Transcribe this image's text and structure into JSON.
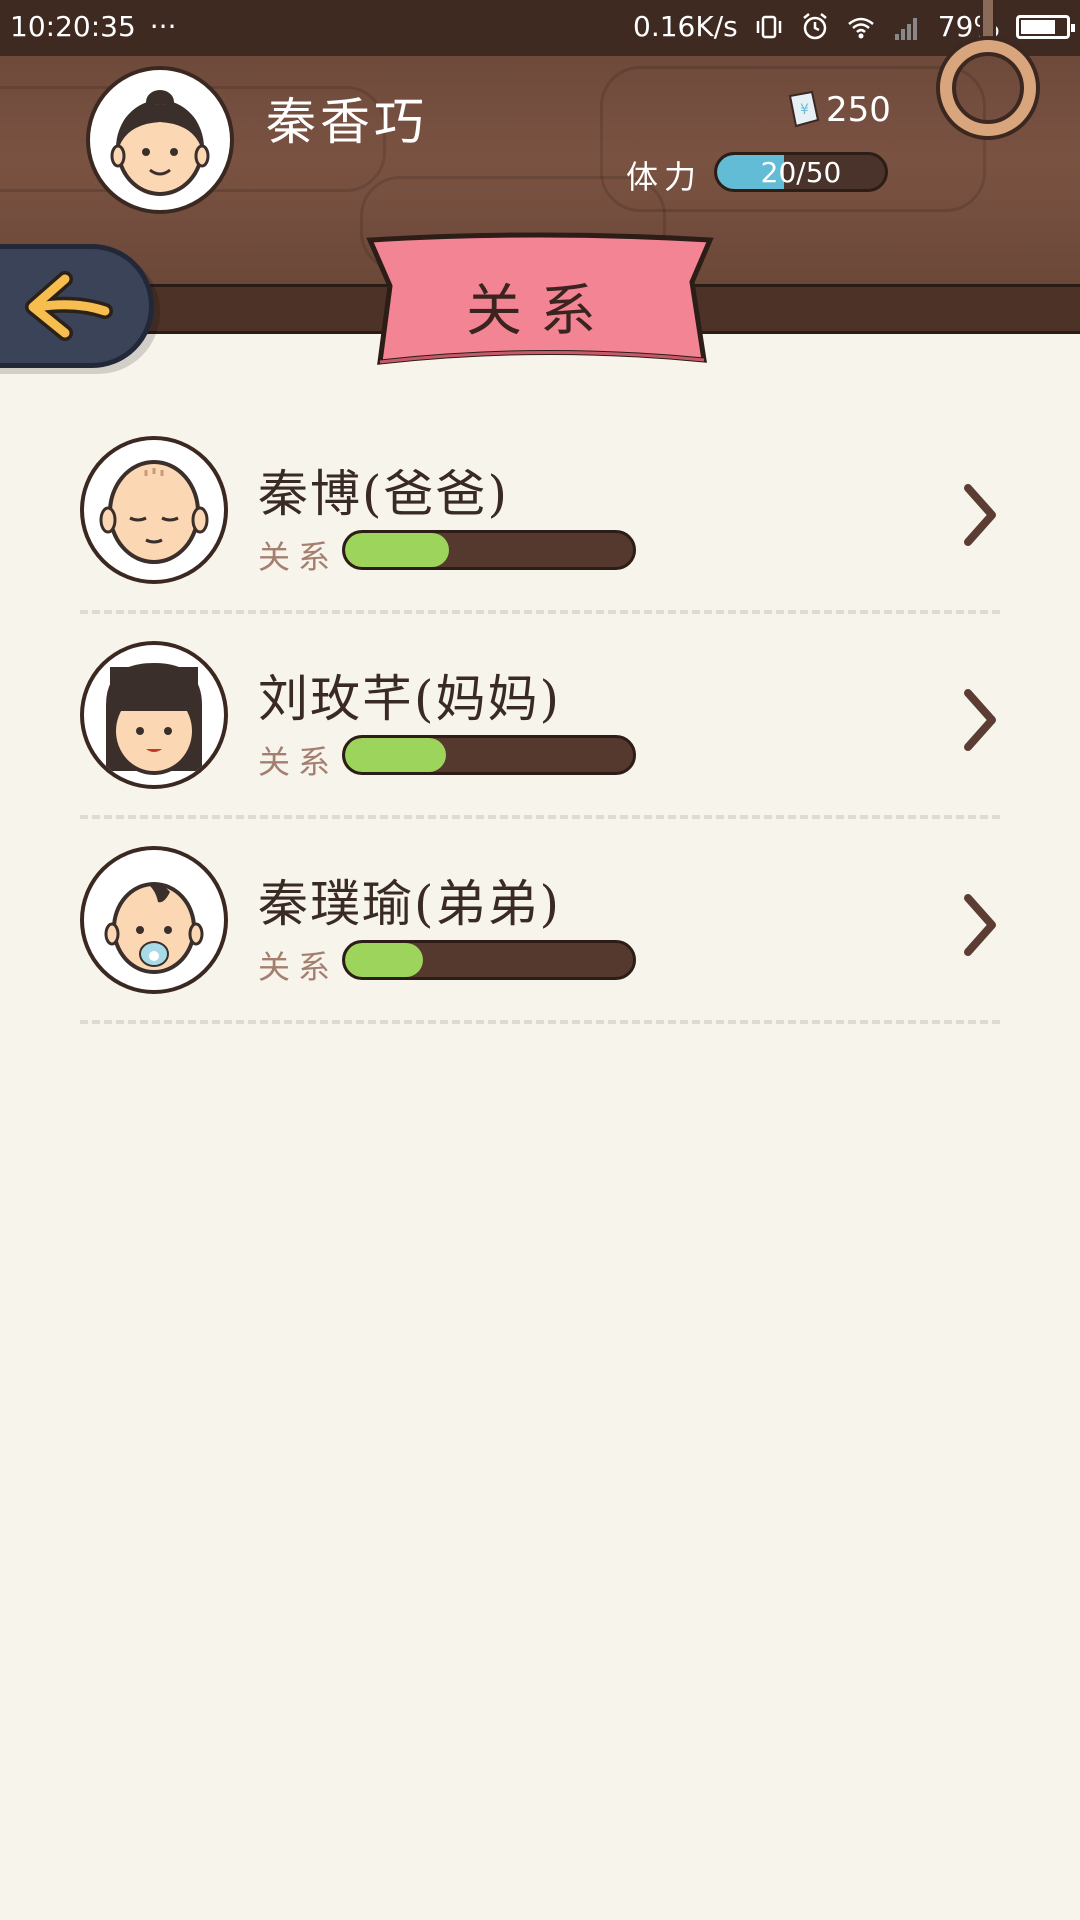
{
  "status_bar": {
    "time": "10:20:35",
    "more": "···",
    "network_speed": "0.16K/s",
    "battery_percent": "79%",
    "battery_level": 0.79,
    "icons": [
      "vibrate-icon",
      "alarm-icon",
      "wifi-icon",
      "signal-icon",
      "battery-icon"
    ]
  },
  "player": {
    "name": "秦香巧",
    "money": "250",
    "stamina_label": "体力",
    "stamina_text": "20/50",
    "stamina_value": 20,
    "stamina_max": 50
  },
  "page": {
    "title": "关系"
  },
  "relations": [
    {
      "name": "秦博(爸爸)",
      "label": "关系",
      "level": 0.36
    },
    {
      "name": "刘玫芊(妈妈)",
      "label": "关系",
      "level": 0.35
    },
    {
      "name": "秦璞瑜(弟弟)",
      "label": "关系",
      "level": 0.27
    }
  ],
  "colors": {
    "wood": "#7a5242",
    "banner": "#f38493",
    "bar_fill": "#9dd45b",
    "stamina_fill": "#62bcd6"
  }
}
